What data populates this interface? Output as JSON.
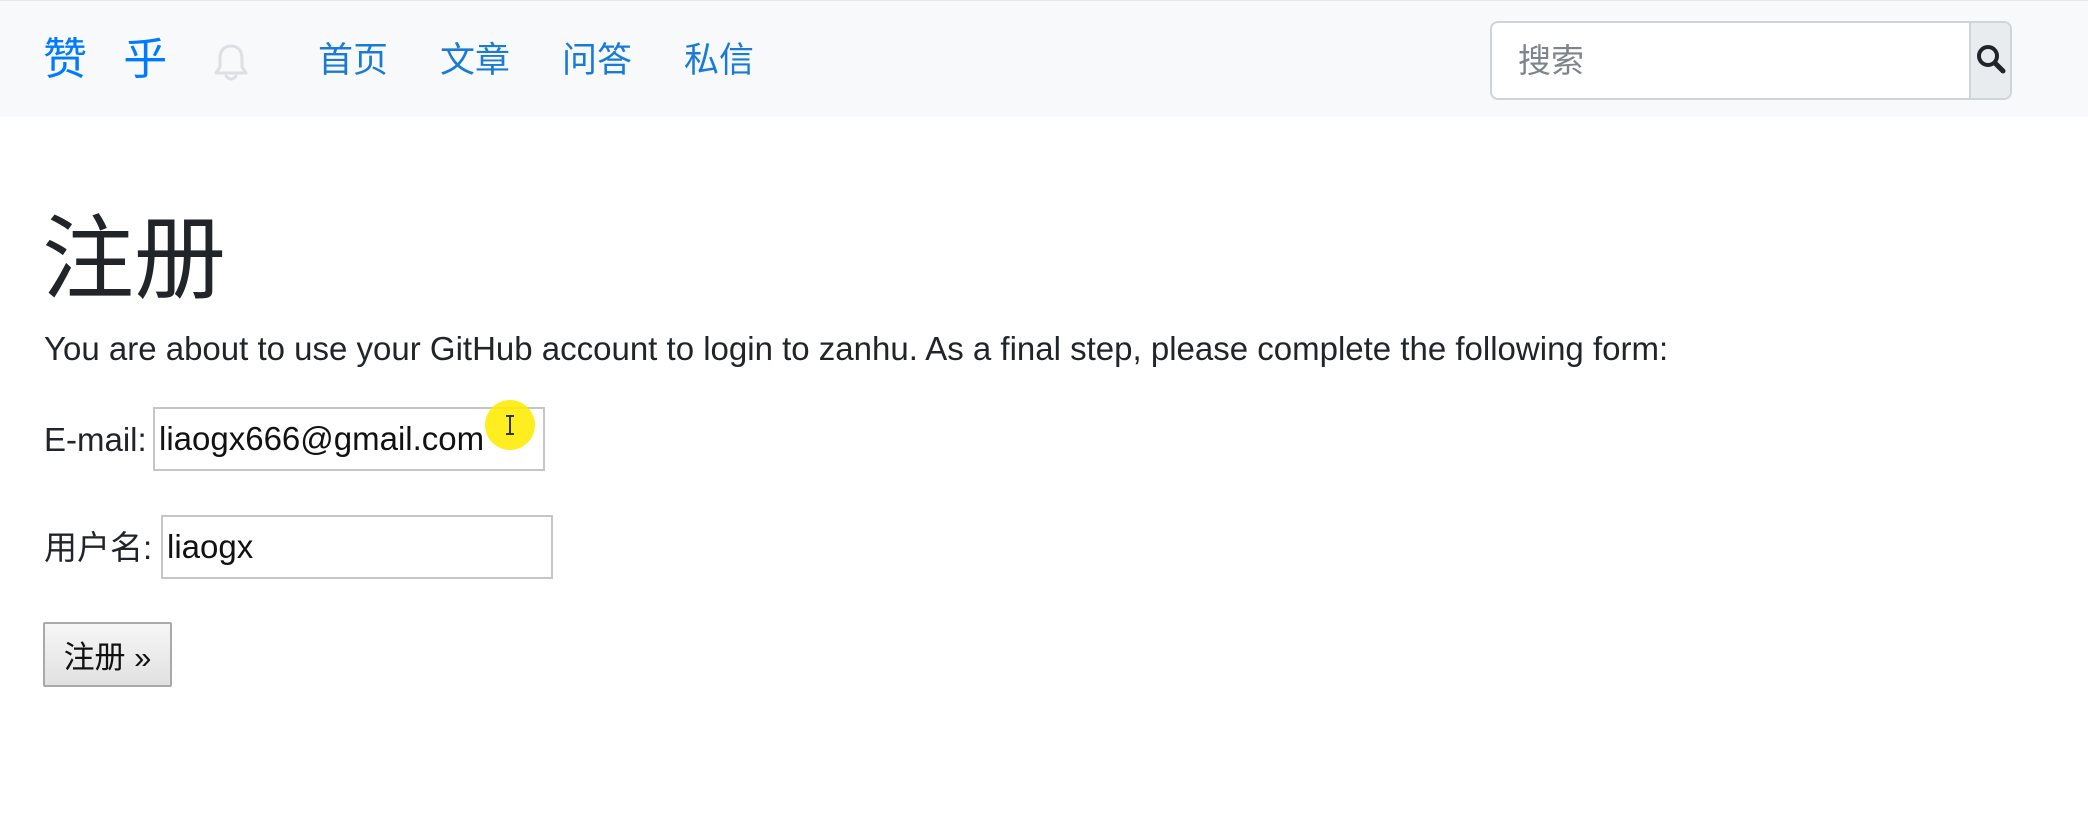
{
  "colors": {
    "accent": "#007bff",
    "navbar_bg": "#f8f9fa",
    "text": "#212529",
    "cursor_highlight": "#ffec00"
  },
  "navbar": {
    "brand": "赞 乎",
    "bell_icon": "bell-icon",
    "links": [
      {
        "label": "首页"
      },
      {
        "label": "文章"
      },
      {
        "label": "问答"
      },
      {
        "label": "私信"
      }
    ],
    "search": {
      "placeholder": "搜索",
      "value": "",
      "button_icon": "search-icon"
    }
  },
  "main": {
    "title": "注册",
    "intro": "You are about to use your GitHub account to login to zanhu. As a final step, please complete the following form:",
    "email": {
      "label": "E-mail:",
      "value": "liaogx666@gmail.com"
    },
    "username": {
      "label": "用户名:",
      "value": "liaogx"
    },
    "submit_label": "注册 »"
  }
}
